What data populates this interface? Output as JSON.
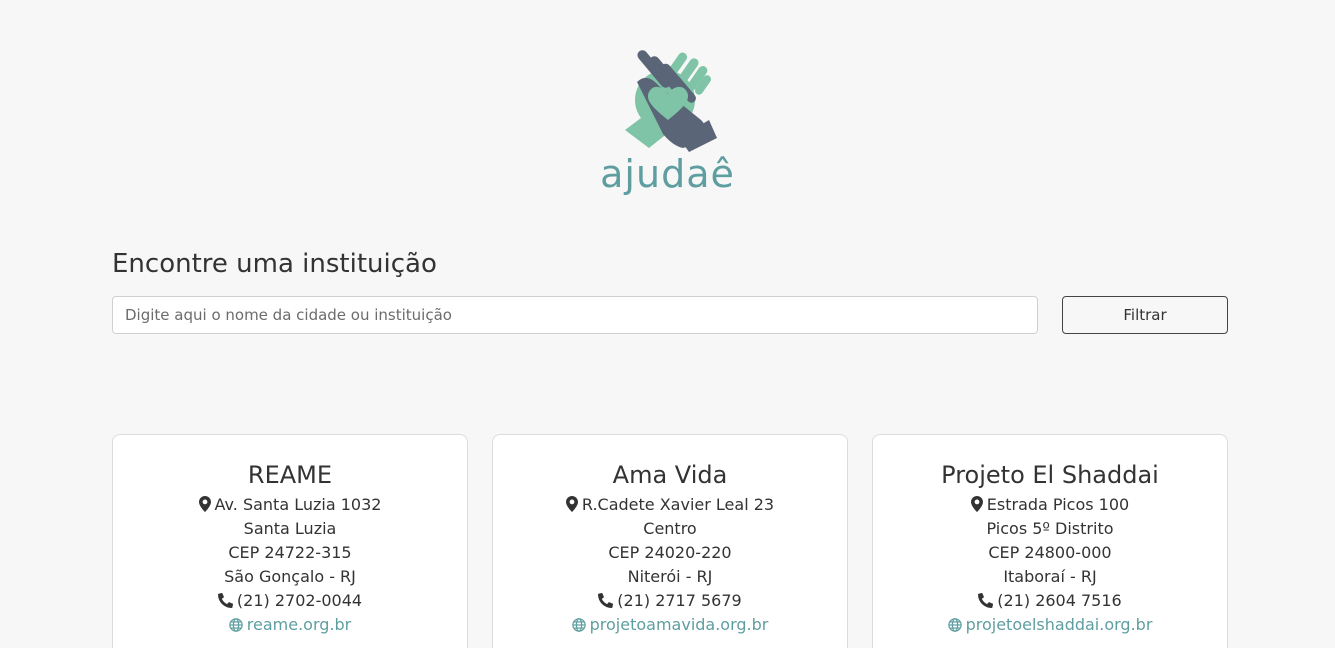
{
  "brand": {
    "name": "ajudaê",
    "colors": {
      "accent": "#5f9ea0",
      "hand_light": "#7fc4a6",
      "hand_dark": "#5a6678"
    }
  },
  "search": {
    "title": "Encontre uma instituição",
    "placeholder": "Digite aqui o nome da cidade ou instituição",
    "value": "",
    "button_label": "Filtrar"
  },
  "institutions": [
    {
      "name": "REAME",
      "address": "Av. Santa Luzia 1032",
      "district": "Santa Luzia",
      "cep": "CEP 24722-315",
      "city": "São Gonçalo - RJ",
      "phone": "(21) 2702-0044",
      "website": "reame.org.br"
    },
    {
      "name": "Ama Vida",
      "address": "R.Cadete Xavier Leal 23",
      "district": "Centro",
      "cep": "CEP 24020-220",
      "city": "Niterói - RJ",
      "phone": "(21) 2717 5679",
      "website": "projetoamavida.org.br"
    },
    {
      "name": "Projeto El Shaddai",
      "address": "Estrada Picos 100",
      "district": "Picos 5º Distrito",
      "cep": "CEP 24800-000",
      "city": "Itaboraí - RJ",
      "phone": "(21) 2604 7516",
      "website": "projetoelshaddai.org.br"
    }
  ]
}
